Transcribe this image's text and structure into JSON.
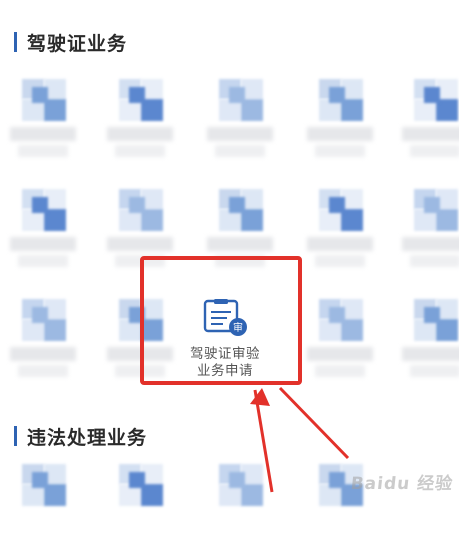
{
  "sections": [
    {
      "title": "驾驶证业务"
    },
    {
      "title": "违法处理业务"
    }
  ],
  "highlighted_service": {
    "label_line1": "驾驶证审验",
    "label_line2": "业务申请",
    "icon": "document-stamp-icon"
  },
  "annotation": {
    "color": "#e2312a",
    "watermark": "Baidu 经验"
  },
  "colors": {
    "accent": "#2e63b3"
  }
}
